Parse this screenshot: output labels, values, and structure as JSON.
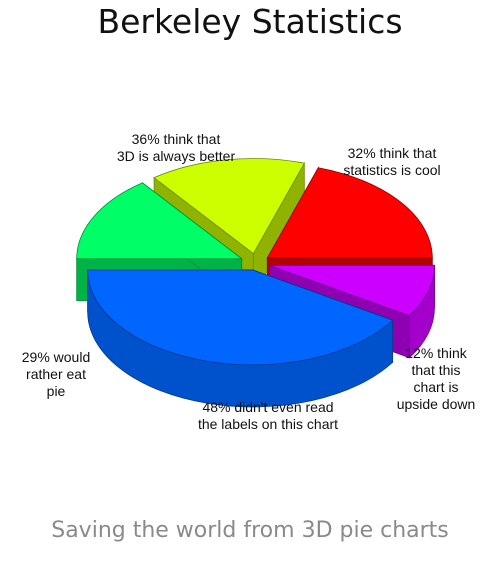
{
  "page": {
    "title": "Berkeley Statistics",
    "subtitle": "Saving the world from 3D pie charts"
  },
  "chart_data": {
    "type": "pie",
    "title": "Berkeley Statistics",
    "subtitle": "Saving the world from 3D pie charts",
    "style": "3D exploded pie, upside down",
    "legend": "none",
    "slices": [
      {
        "label": "32% think that statistics is cool",
        "value": 32,
        "color": "#ff0000"
      },
      {
        "label": "12% think that this chart is upside down",
        "value": 12,
        "color": "#cc00ff"
      },
      {
        "label": "48% didn't even read the labels on this chart",
        "value": 48,
        "color": "#0066ff"
      },
      {
        "label": "29% would rather eat pie",
        "value": 29,
        "color": "#00ff66"
      },
      {
        "label": "36% think that 3D is always better",
        "value": 36,
        "color": "#ccff00"
      }
    ]
  }
}
